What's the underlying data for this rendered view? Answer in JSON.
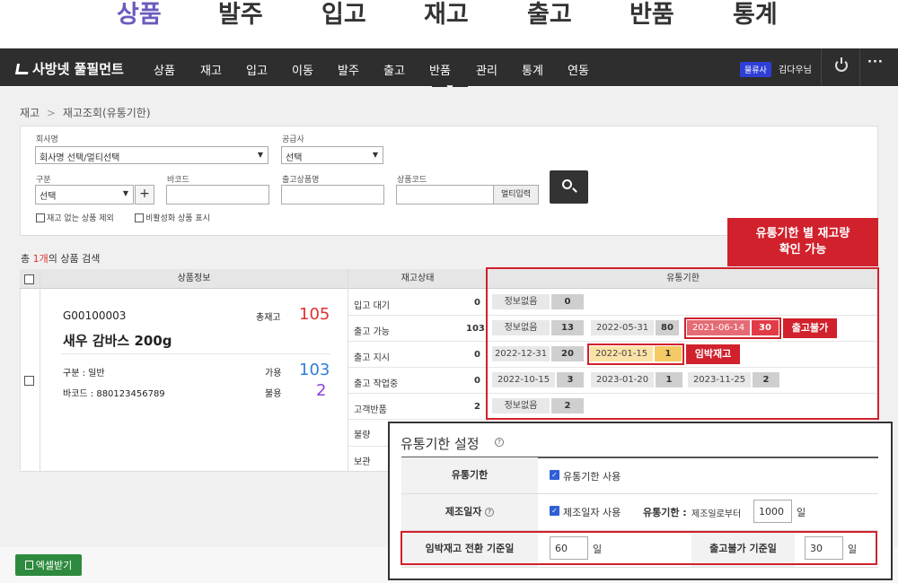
{
  "top_tabs": [
    "상품",
    "발주",
    "입고",
    "재고",
    "출고",
    "반품",
    "통계"
  ],
  "nav": {
    "logo": "사방넷 풀필먼트",
    "menu": [
      "상품",
      "재고",
      "입고",
      "이동",
      "발주",
      "출고",
      "반품",
      "관리",
      "통계",
      "연동"
    ],
    "badge": "물류사",
    "user": "김다우님",
    "dropdown_arrow": "▼",
    "more": "···"
  },
  "breadcrumb": {
    "root": "재고",
    "sep": ">",
    "current": "재고조회(유통기한)"
  },
  "filters": {
    "company_label": "회사명",
    "company_value": "회사명 선택/멀티선택",
    "supplier_label": "공급사",
    "supplier_value": "선택",
    "type_label": "구분",
    "type_value": "선택",
    "plus": "+",
    "barcode_label": "바코드",
    "product_name_label": "출고상품명",
    "product_code_label": "상품코드",
    "multi_input": "멀티입력",
    "check_no_stock": "재고 없는 상품 제외",
    "check_inactive": "비활성화 상품 표시"
  },
  "result": {
    "prefix": "총 ",
    "count": "1개",
    "suffix": "의 상품 검색"
  },
  "table": {
    "headers": [
      "상품정보",
      "재고상태",
      "유통기한"
    ],
    "product": {
      "code": "G00100003",
      "name": "새우 감바스 200g",
      "type": "구분 : 일반",
      "barcode": "바코드 : 880123456789",
      "total_label": "총재고",
      "total": "105",
      "available_label": "가용",
      "available": "103",
      "defective_label": "불용",
      "defective": "2"
    },
    "status_rows": [
      {
        "label": "입고 대기",
        "value": "0"
      },
      {
        "label": "출고 가능",
        "value": "103"
      },
      {
        "label": "출고 지시",
        "value": "0"
      },
      {
        "label": "출고 작업중",
        "value": "0"
      },
      {
        "label": "고객반품",
        "value": "2"
      },
      {
        "label": "불량",
        "value": ""
      },
      {
        "label": "보관",
        "value": ""
      }
    ],
    "expiry_rows": [
      [
        {
          "date": "정보없음",
          "qty": "0"
        }
      ],
      [
        {
          "date": "정보없음",
          "qty": "13"
        },
        {
          "date": "2022-05-31",
          "qty": "80"
        },
        {
          "date": "2021-06-14",
          "qty": "30"
        }
      ],
      [
        {
          "date": "2022-12-31",
          "qty": "20"
        },
        {
          "date": "2022-01-15",
          "qty": "1"
        }
      ],
      [
        {
          "date": "2022-10-15",
          "qty": "3"
        },
        {
          "date": "2023-01-20",
          "qty": "1"
        },
        {
          "date": "2023-11-25",
          "qty": "2"
        }
      ],
      [
        {
          "date": "정보없음",
          "qty": "2"
        }
      ]
    ]
  },
  "callouts": {
    "expiry_stock": "유통기한 별 재고량\n확인 가능",
    "no_outbound": "출고불가",
    "imminent": "임박재고"
  },
  "settings": {
    "title": "유통기한 설정",
    "help": "?",
    "expiry_label": "유통기한",
    "expiry_check": "유통기한 사용",
    "mfg_label": "제조일자",
    "mfg_check": "제조일자 사용",
    "mfg_expiry_label": "유통기한 : ",
    "mfg_expiry_text": "제조일로부터",
    "mfg_days": "1000",
    "day_unit": "일",
    "imminent_label": "임박재고 전환 기준일",
    "imminent_days": "60",
    "no_out_label": "출고불가 기준일",
    "no_out_days": "30"
  },
  "excel_button": "엑셀받기",
  "colors": {
    "accent_purple": "#6b5bbd",
    "nav_bg": "#2e2e2e",
    "alert_red": "#d0212c",
    "excel_green": "#2e8a3e",
    "blue_value": "#2f7fd6"
  }
}
